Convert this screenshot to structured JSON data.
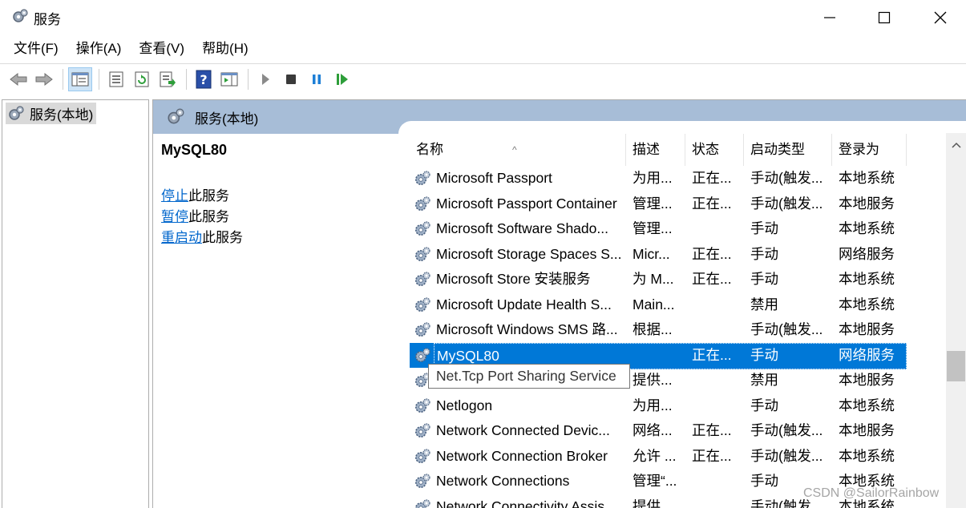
{
  "window": {
    "title": "服务",
    "controls": {
      "minimize": "minimize-icon",
      "maximize": "maximize-icon",
      "close": "close-icon"
    }
  },
  "menu": [
    "文件(F)",
    "操作(A)",
    "查看(V)",
    "帮助(H)"
  ],
  "toolbar": {
    "icons": [
      "back-arrow-icon",
      "forward-arrow-icon",
      "console-tree-icon",
      "properties-icon",
      "refresh-icon",
      "export-list-icon",
      "help-icon",
      "show-action-pane-icon",
      "start-service-icon",
      "stop-service-icon",
      "pause-service-icon",
      "restart-service-icon"
    ]
  },
  "tree": {
    "root_label": "服务(本地)"
  },
  "panel": {
    "header": "服务(本地)",
    "selected_service": "MySQL80",
    "actions": [
      {
        "link": "停止",
        "suffix": "此服务"
      },
      {
        "link": "暂停",
        "suffix": "此服务"
      },
      {
        "link": "重启动",
        "suffix": "此服务"
      }
    ]
  },
  "list": {
    "columns": [
      "名称",
      "描述",
      "状态",
      "启动类型",
      "登录为"
    ],
    "rows": [
      {
        "name": "Microsoft Passport",
        "desc": "为用...",
        "status": "正在...",
        "startup": "手动(触发...",
        "logon": "本地系统"
      },
      {
        "name": "Microsoft Passport Container",
        "desc": "管理...",
        "status": "正在...",
        "startup": "手动(触发...",
        "logon": "本地服务"
      },
      {
        "name": "Microsoft Software Shado...",
        "desc": "管理...",
        "status": "",
        "startup": "手动",
        "logon": "本地系统"
      },
      {
        "name": "Microsoft Storage Spaces S...",
        "desc": "Micr...",
        "status": "正在...",
        "startup": "手动",
        "logon": "网络服务"
      },
      {
        "name": "Microsoft Store 安装服务",
        "desc": "为 M...",
        "status": "正在...",
        "startup": "手动",
        "logon": "本地系统"
      },
      {
        "name": "Microsoft Update Health S...",
        "desc": "Main...",
        "status": "",
        "startup": "禁用",
        "logon": "本地系统"
      },
      {
        "name": "Microsoft Windows SMS 路...",
        "desc": "根据...",
        "status": "",
        "startup": "手动(触发...",
        "logon": "本地服务"
      },
      {
        "name": "MySQL80",
        "desc": "",
        "status": "正在...",
        "startup": "手动",
        "logon": "网络服务"
      },
      {
        "name": "",
        "desc": "提供...",
        "status": "",
        "startup": "禁用",
        "logon": "本地服务"
      },
      {
        "name": "Netlogon",
        "desc": "为用...",
        "status": "",
        "startup": "手动",
        "logon": "本地系统"
      },
      {
        "name": "Network Connected Devic...",
        "desc": "网络...",
        "status": "正在...",
        "startup": "手动(触发...",
        "logon": "本地服务"
      },
      {
        "name": "Network Connection Broker",
        "desc": "允许 ...",
        "status": "正在...",
        "startup": "手动(触发...",
        "logon": "本地系统"
      },
      {
        "name": "Network Connections",
        "desc": "管理“...",
        "status": "",
        "startup": "手动",
        "logon": "本地系统"
      },
      {
        "name": "Network Connectivity Assis...",
        "desc": "提供 ...",
        "status": "",
        "startup": "手动(触发...",
        "logon": "本地系统"
      }
    ],
    "tooltip": "Net.Tcp Port Sharing Service"
  },
  "watermark": "CSDN @SailorRainbow",
  "colors": {
    "selection": "#0078d7",
    "header_band": "#a7bdd7",
    "link": "#0066cc"
  }
}
